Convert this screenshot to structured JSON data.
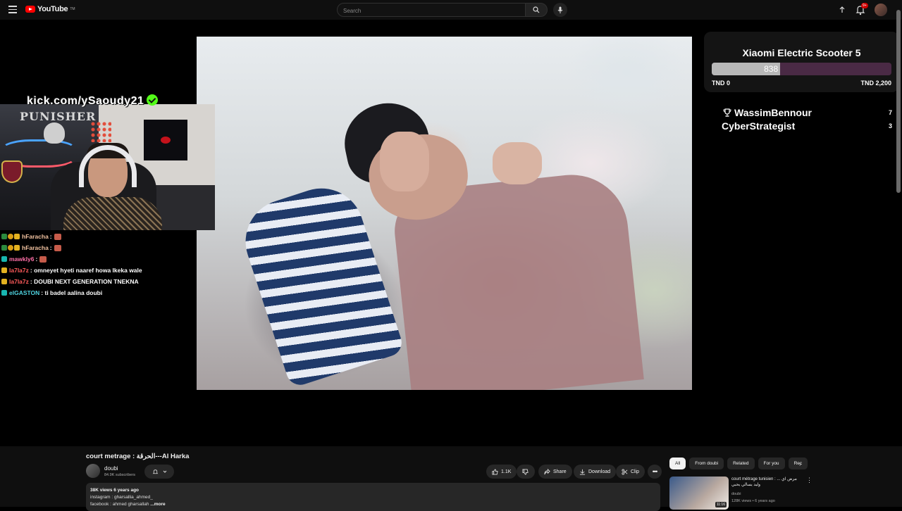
{
  "header": {
    "logo_text": "YouTube",
    "logo_tm": "TM",
    "search_placeholder": "Search",
    "notification_count": "9+"
  },
  "overlay": {
    "kick_url": "kick.com/ySaoudy21",
    "webcam_sign": "PUNISHER",
    "chat": [
      {
        "user": "hFaracha",
        "message": ":",
        "emote": true,
        "badges": [
          "green",
          "gold",
          "crown"
        ],
        "color_class": "u-peach"
      },
      {
        "user": "hFaracha",
        "message": ":",
        "emote": true,
        "badges": [
          "green",
          "gold",
          "crown"
        ],
        "color_class": "u-peach"
      },
      {
        "user": "mawkly6",
        "message": ":",
        "emote": true,
        "badges": [
          "teal"
        ],
        "color_class": "u-pink"
      },
      {
        "user": "la7la7z",
        "message": ": omneyet hyeti naaref howa lkeka wale",
        "emote": false,
        "badges": [
          "crown"
        ],
        "color_class": "u-red"
      },
      {
        "user": "la7la7z",
        "message": ": DOUBI NEXT GENERATION TNEKNA",
        "emote": false,
        "badges": [
          "crown"
        ],
        "color_class": "u-red"
      },
      {
        "user": "elGASTON",
        "message": ": ti badel aalina doubi",
        "emote": false,
        "badges": [
          "teal"
        ],
        "color_class": "u-teal"
      }
    ],
    "goal": {
      "title": "Xiaomi Electric Scooter 5",
      "current": "838",
      "current_value": 838,
      "min_label": "TND 0",
      "max_label": "TND 2,200",
      "max_value": 2200,
      "fill_color": "#b8b8b8",
      "track_color": "#4a2a45"
    },
    "leaderboard": [
      {
        "name": "WassimBennour",
        "count": "7",
        "icon": "trophy-icon"
      },
      {
        "name": "CyberStrategist",
        "count": "3",
        "icon": ""
      }
    ]
  },
  "video": {
    "title": "court metrage : الحرقة---Al Harka",
    "channel": "doubi",
    "subscribers": "84.9K subscribers",
    "likes": "1.1K",
    "share_label": "Share",
    "download_label": "Download",
    "clip_label": "Clip",
    "description": {
      "stats": "38K views  6 years ago",
      "line1": "instagram : gharsallia_ahmed_",
      "line2": "facebook : ahmed gharsallah",
      "more": " ...more"
    }
  },
  "recommendations": {
    "chips": [
      "All",
      "From doubi",
      "Related",
      "For you",
      "Rec"
    ],
    "items": [
      {
        "title": "court métrage tunisien : مرض اي ... وليد يسالي يحبي",
        "channel": "doubi",
        "meta": "128K views • 6 years ago",
        "duration": "11:16"
      }
    ]
  },
  "colors": {
    "accent": "#ff0000",
    "kick_green": "#53fc18",
    "background": "#0f0f0f"
  }
}
